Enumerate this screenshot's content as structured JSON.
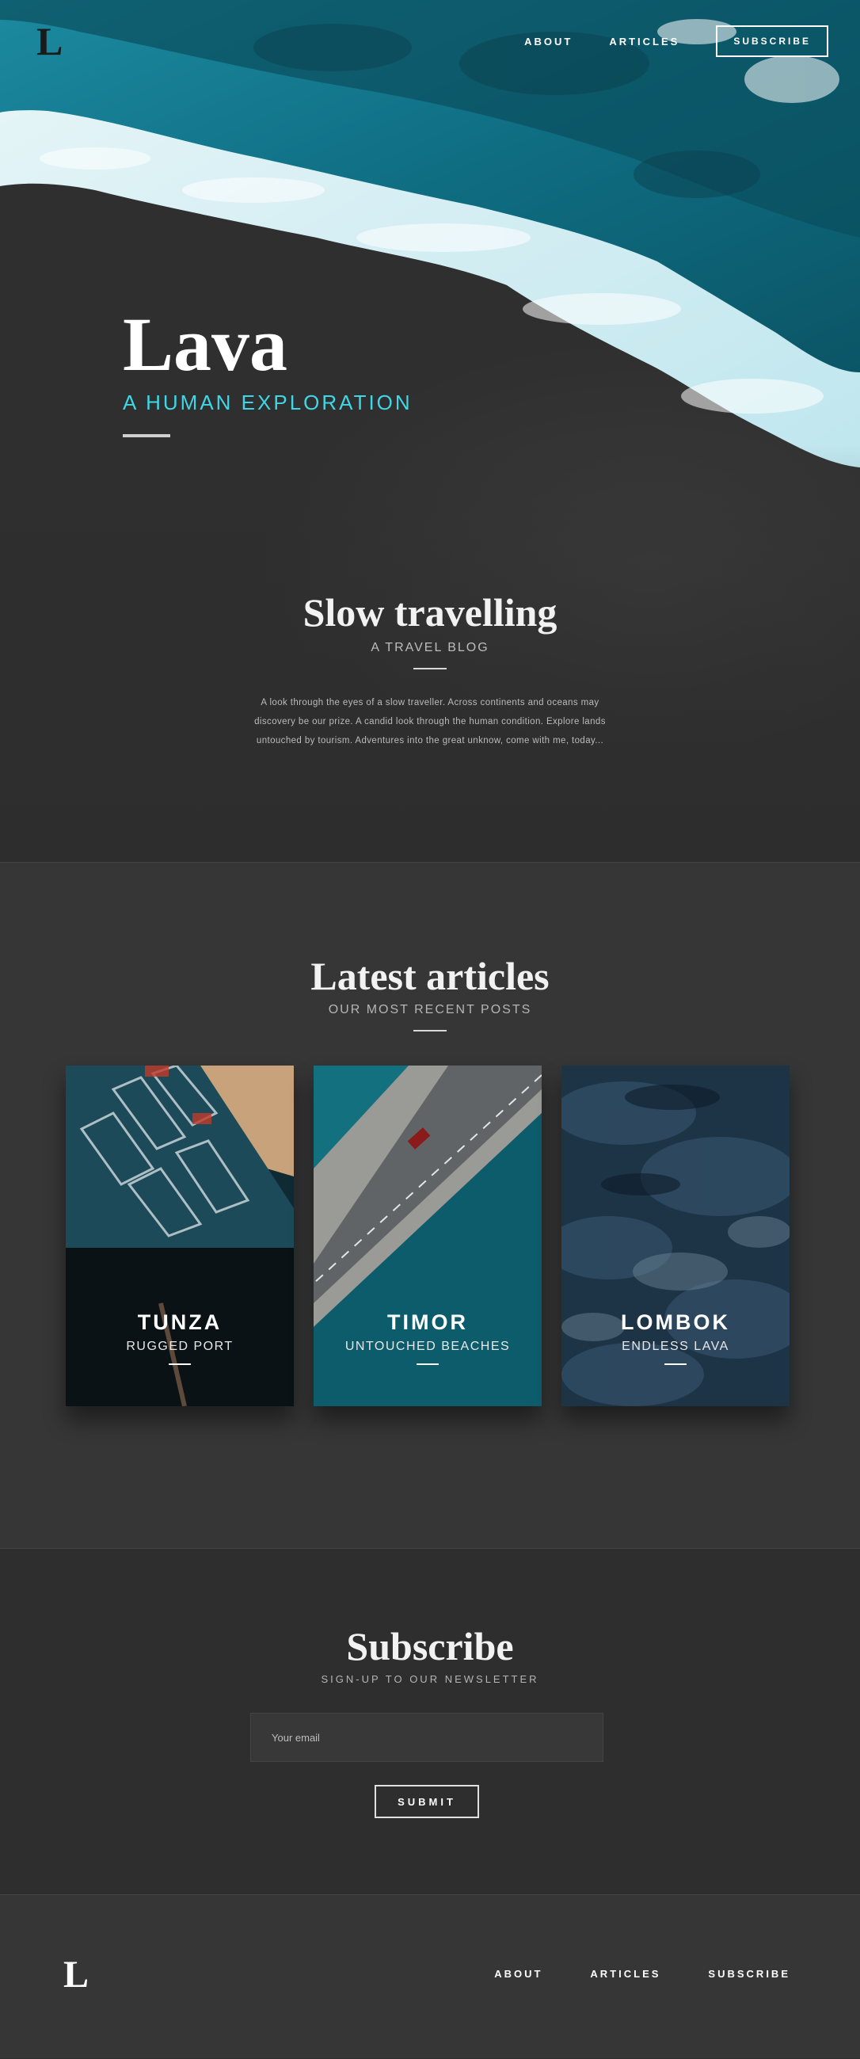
{
  "nav": {
    "logo": "L",
    "about": "ABOUT",
    "articles": "ARTICLES",
    "subscribe": "SUBSCRIBE"
  },
  "hero": {
    "title": "Lava",
    "subtitle": "A HUMAN EXPLORATION"
  },
  "intro": {
    "title": "Slow travelling",
    "subtitle": "A TRAVEL BLOG",
    "body": "A look through the eyes of a slow traveller. Across continents and oceans may discovery be our prize. A candid look through the human condition. Explore lands untouched by tourism. Adventures into the great unknow, come with me, today..."
  },
  "latest": {
    "title": "Latest articles",
    "subtitle": "OUR MOST RECENT POSTS",
    "cards": [
      {
        "title": "TUNZA",
        "subtitle": "RUGGED PORT"
      },
      {
        "title": "TIMOR",
        "subtitle": "UNTOUCHED BEACHES"
      },
      {
        "title": "LOMBOK",
        "subtitle": "ENDLESS LAVA"
      }
    ]
  },
  "subscribe": {
    "title": "Subscribe",
    "subtitle": "SIGN-UP TO OUR NEWSLETTER",
    "email_placeholder": "Your email",
    "submit_label": "SUBMIT"
  },
  "footer": {
    "logo": "L",
    "about": "ABOUT",
    "articles": "ARTICLES",
    "subscribe": "SUBSCRIBE"
  },
  "colors": {
    "accent": "#3fd7e6",
    "background": "#2d2d2d",
    "section": "#363636"
  }
}
